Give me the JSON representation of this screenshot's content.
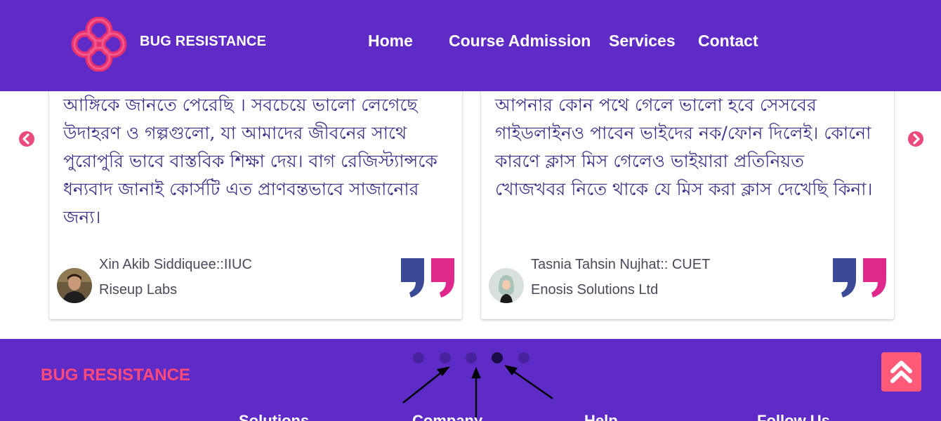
{
  "header": {
    "brand": "BUG RESISTANCE",
    "logo_icon": "clover-knot-logo",
    "nav": [
      "Home",
      "Course Admission",
      "Services",
      "Contact"
    ]
  },
  "testimonials": [
    {
      "text": "আঙ্গিকে জানতে পেরেছি । সবচেয়ে ভালো লেগেছে উদাহরণ ও গল্পগুলো, যা আমাদের জীবনের সাথে পুরোপুরি ভাবে বাস্তবিক শিক্ষা দেয়। বাগ রেজিস্ট্যান্সকে ধন্যবাদ জানাই কোর্সটি এত প্রাণবন্তভাবে সাজানোর জন্য।",
      "name": "Xin Akib Siddiquee::IIUC",
      "company": "Riseup Labs"
    },
    {
      "text": "আপনার কোন পথে গেলে ভালো হবে সেসবের গাইডলাইনও পাবেন ভাইদের নক/ফোন দিলেই। কোনো কারণে ক্লাস মিস গেলেও ভাইয়ারা প্রতিনিয়ত খোজখবর নিতে থাকে যে মিস করা ক্লাস দেখেছি কিনা।",
      "name": "Tasnia Tahsin Nujhat:: CUET",
      "company": "Enosis Solutions Ltd"
    }
  ],
  "carousel": {
    "dot_count": 5,
    "active_dot": 4,
    "prev_icon": "chevron-left-circle-icon",
    "next_icon": "chevron-right-circle-icon"
  },
  "footer": {
    "brand": "BUG RESISTANCE",
    "columns": [
      "Solutions",
      "Company",
      "Help",
      "Follow Us"
    ],
    "scroll_top_icon": "double-chevron-up-icon"
  },
  "colors": {
    "primary": "#5e2bc6",
    "accent": "#ec4a7c",
    "quote_blue": "#3a4a96",
    "quote_pink": "#e0288c",
    "footer_brand": "#ff4a79",
    "scroll_button": "#ff5a78"
  }
}
